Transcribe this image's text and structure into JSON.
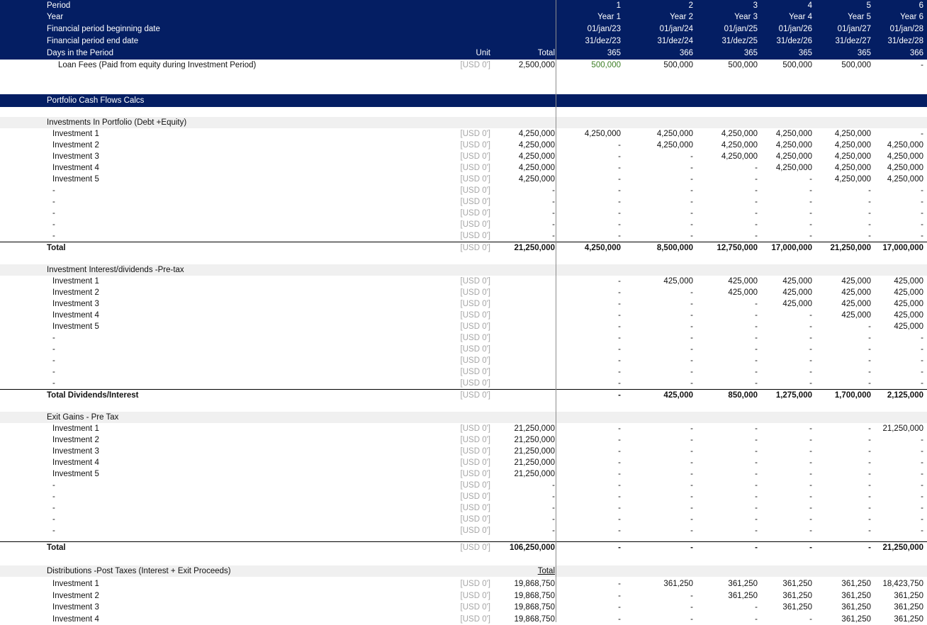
{
  "header": {
    "rows": [
      {
        "label": "Period",
        "unit": "",
        "total": "",
        "years": [
          "1",
          "2",
          "3",
          "4",
          "5",
          "6"
        ]
      },
      {
        "label": "Year",
        "unit": "",
        "total": "",
        "years": [
          "Year 1",
          "Year 2",
          "Year 3",
          "Year 4",
          "Year 5",
          "Year 6"
        ]
      },
      {
        "label": "Financial period beginning date",
        "unit": "",
        "total": "",
        "years": [
          "01/jan/23",
          "01/jan/24",
          "01/jan/25",
          "01/jan/26",
          "01/jan/27",
          "01/jan/28"
        ]
      },
      {
        "label": "Financial period end date",
        "unit": "",
        "total": "",
        "years": [
          "31/dez/23",
          "31/dez/24",
          "31/dez/25",
          "31/dez/26",
          "31/dez/27",
          "31/dez/28"
        ]
      },
      {
        "label": "Days in the Period",
        "unit": "Unit",
        "total": "Total",
        "years": [
          "365",
          "366",
          "365",
          "365",
          "365",
          "366"
        ]
      }
    ]
  },
  "loan_fees": {
    "label": "Loan Fees (Paid from equity during Investment Period)",
    "unit": "[USD 0']",
    "total": "2,500,000",
    "years": [
      "500,000",
      "500,000",
      "500,000",
      "500,000",
      "500,000",
      "-"
    ]
  },
  "section_title": "Portfolio Cash Flows Calcs",
  "investments": {
    "title": "Investments In Portfolio (Debt +Equity)",
    "rows": [
      {
        "label": "Investment 1",
        "unit": "[USD 0']",
        "total": "4,250,000",
        "years": [
          "4,250,000",
          "4,250,000",
          "4,250,000",
          "4,250,000",
          "4,250,000",
          "-"
        ]
      },
      {
        "label": "Investment 2",
        "unit": "[USD 0']",
        "total": "4,250,000",
        "years": [
          "-",
          "4,250,000",
          "4,250,000",
          "4,250,000",
          "4,250,000",
          "4,250,000"
        ]
      },
      {
        "label": "Investment 3",
        "unit": "[USD 0']",
        "total": "4,250,000",
        "years": [
          "-",
          "-",
          "4,250,000",
          "4,250,000",
          "4,250,000",
          "4,250,000"
        ]
      },
      {
        "label": "Investment 4",
        "unit": "[USD 0']",
        "total": "4,250,000",
        "years": [
          "-",
          "-",
          "-",
          "4,250,000",
          "4,250,000",
          "4,250,000"
        ]
      },
      {
        "label": "Investment 5",
        "unit": "[USD 0']",
        "total": "4,250,000",
        "years": [
          "-",
          "-",
          "-",
          "-",
          "4,250,000",
          "4,250,000"
        ]
      },
      {
        "label": "-",
        "unit": "[USD 0']",
        "total": "-",
        "years": [
          "-",
          "-",
          "-",
          "-",
          "-",
          "-"
        ]
      },
      {
        "label": "-",
        "unit": "[USD 0']",
        "total": "-",
        "years": [
          "-",
          "-",
          "-",
          "-",
          "-",
          "-"
        ]
      },
      {
        "label": "-",
        "unit": "[USD 0']",
        "total": "-",
        "years": [
          "-",
          "-",
          "-",
          "-",
          "-",
          "-"
        ]
      },
      {
        "label": "-",
        "unit": "[USD 0']",
        "total": "-",
        "years": [
          "-",
          "-",
          "-",
          "-",
          "-",
          "-"
        ]
      },
      {
        "label": "-",
        "unit": "[USD 0']",
        "total": "-",
        "years": [
          "-",
          "-",
          "-",
          "-",
          "-",
          "-"
        ]
      }
    ],
    "total": {
      "label": "Total",
      "unit": "[USD 0']",
      "total": "21,250,000",
      "years": [
        "4,250,000",
        "8,500,000",
        "12,750,000",
        "17,000,000",
        "21,250,000",
        "17,000,000"
      ]
    }
  },
  "interest": {
    "title": "Investment Interest/dividends -Pre-tax",
    "rows": [
      {
        "label": "Investment 1",
        "unit": "[USD 0']",
        "total": "",
        "years": [
          "-",
          "425,000",
          "425,000",
          "425,000",
          "425,000",
          "425,000"
        ]
      },
      {
        "label": "Investment 2",
        "unit": "[USD 0']",
        "total": "",
        "years": [
          "-",
          "-",
          "425,000",
          "425,000",
          "425,000",
          "425,000"
        ]
      },
      {
        "label": "Investment 3",
        "unit": "[USD 0']",
        "total": "",
        "years": [
          "-",
          "-",
          "-",
          "425,000",
          "425,000",
          "425,000"
        ]
      },
      {
        "label": "Investment 4",
        "unit": "[USD 0']",
        "total": "",
        "years": [
          "-",
          "-",
          "-",
          "-",
          "425,000",
          "425,000"
        ]
      },
      {
        "label": "Investment 5",
        "unit": "[USD 0']",
        "total": "",
        "years": [
          "-",
          "-",
          "-",
          "-",
          "-",
          "425,000"
        ]
      },
      {
        "label": "-",
        "unit": "[USD 0']",
        "total": "",
        "years": [
          "-",
          "-",
          "-",
          "-",
          "-",
          "-"
        ]
      },
      {
        "label": "-",
        "unit": "[USD 0']",
        "total": "",
        "years": [
          "-",
          "-",
          "-",
          "-",
          "-",
          "-"
        ]
      },
      {
        "label": "-",
        "unit": "[USD 0']",
        "total": "",
        "years": [
          "-",
          "-",
          "-",
          "-",
          "-",
          "-"
        ]
      },
      {
        "label": "-",
        "unit": "[USD 0']",
        "total": "",
        "years": [
          "-",
          "-",
          "-",
          "-",
          "-",
          "-"
        ]
      },
      {
        "label": "-",
        "unit": "[USD 0']",
        "total": "",
        "years": [
          "-",
          "-",
          "-",
          "-",
          "-",
          "-"
        ]
      }
    ],
    "total": {
      "label": "Total Dividends/Interest",
      "unit": "[USD 0']",
      "total": "",
      "years": [
        "-",
        "425,000",
        "850,000",
        "1,275,000",
        "1,700,000",
        "2,125,000"
      ]
    }
  },
  "exit_gains": {
    "title": "Exit Gains - Pre Tax",
    "rows": [
      {
        "label": "Investment 1",
        "unit": "[USD 0']",
        "total": "21,250,000",
        "years": [
          "-",
          "-",
          "-",
          "-",
          "-",
          "21,250,000"
        ]
      },
      {
        "label": "Investment 2",
        "unit": "[USD 0']",
        "total": "21,250,000",
        "years": [
          "-",
          "-",
          "-",
          "-",
          "-",
          "-"
        ]
      },
      {
        "label": "Investment 3",
        "unit": "[USD 0']",
        "total": "21,250,000",
        "years": [
          "-",
          "-",
          "-",
          "-",
          "-",
          "-"
        ]
      },
      {
        "label": "Investment 4",
        "unit": "[USD 0']",
        "total": "21,250,000",
        "years": [
          "-",
          "-",
          "-",
          "-",
          "-",
          "-"
        ]
      },
      {
        "label": "Investment 5",
        "unit": "[USD 0']",
        "total": "21,250,000",
        "years": [
          "-",
          "-",
          "-",
          "-",
          "-",
          "-"
        ]
      },
      {
        "label": "-",
        "unit": "[USD 0']",
        "total": "-",
        "years": [
          "-",
          "-",
          "-",
          "-",
          "-",
          "-"
        ]
      },
      {
        "label": "-",
        "unit": "[USD 0']",
        "total": "-",
        "years": [
          "-",
          "-",
          "-",
          "-",
          "-",
          "-"
        ]
      },
      {
        "label": "-",
        "unit": "[USD 0']",
        "total": "-",
        "years": [
          "-",
          "-",
          "-",
          "-",
          "-",
          "-"
        ]
      },
      {
        "label": "-",
        "unit": "[USD 0']",
        "total": "-",
        "years": [
          "-",
          "-",
          "-",
          "-",
          "-",
          "-"
        ]
      },
      {
        "label": "-",
        "unit": "[USD 0']",
        "total": "-",
        "years": [
          "-",
          "-",
          "-",
          "-",
          "-",
          "-"
        ]
      }
    ],
    "total": {
      "label": "Total",
      "unit": "[USD 0']",
      "total": "106,250,000",
      "years": [
        "-",
        "-",
        "-",
        "-",
        "-",
        "21,250,000"
      ]
    }
  },
  "distributions": {
    "title": "Distributions -Post Taxes (Interest + Exit Proceeds)",
    "total_header": "Total",
    "rows": [
      {
        "label": "Investment 1",
        "unit": "[USD 0']",
        "total": "19,868,750",
        "years": [
          "-",
          "361,250",
          "361,250",
          "361,250",
          "361,250",
          "18,423,750"
        ]
      },
      {
        "label": "Investment 2",
        "unit": "[USD 0']",
        "total": "19,868,750",
        "years": [
          "-",
          "-",
          "361,250",
          "361,250",
          "361,250",
          "361,250"
        ]
      },
      {
        "label": "Investment 3",
        "unit": "[USD 0']",
        "total": "19,868,750",
        "years": [
          "-",
          "-",
          "-",
          "361,250",
          "361,250",
          "361,250"
        ]
      },
      {
        "label": "Investment 4",
        "unit": "[USD 0']",
        "total": "19,868,750",
        "years": [
          "-",
          "-",
          "-",
          "-",
          "361,250",
          "361,250"
        ]
      }
    ]
  },
  "colors": {
    "header_bg": "#041e63",
    "header_text": "#ffffff",
    "unit_text": "#a6a6a6",
    "input_green": "#3b7d23",
    "shade": "#f0f0f0"
  }
}
